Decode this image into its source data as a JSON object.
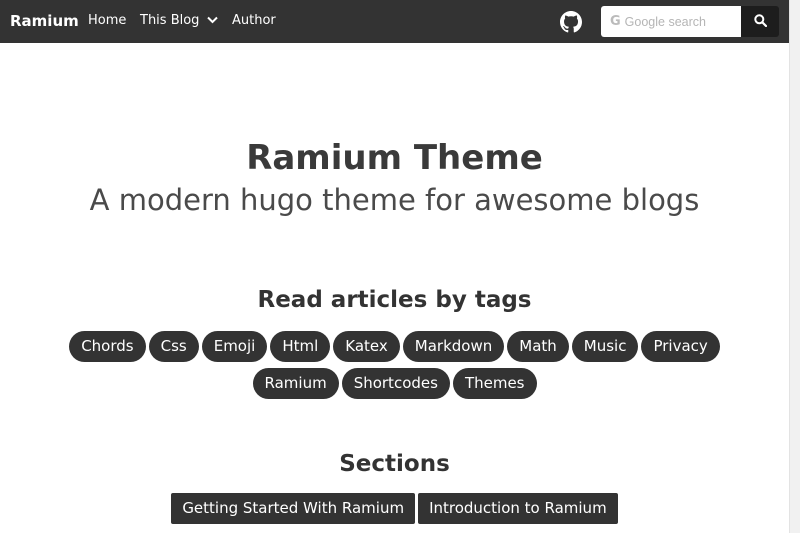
{
  "navbar": {
    "brand": "Ramium",
    "links": {
      "home": "Home",
      "blog": "This Blog",
      "author": "Author"
    },
    "search": {
      "placeholder": "Google search"
    },
    "colors": {
      "background": "#333333",
      "search_button": "#1d1d1d"
    }
  },
  "hero": {
    "title": "Ramium Theme",
    "subtitle": "A modern hugo theme for awesome blogs"
  },
  "tags": {
    "heading": "Read articles by tags",
    "row1": [
      "Chords",
      "Css",
      "Emoji",
      "Html",
      "Katex",
      "Markdown",
      "Math",
      "Music",
      "Privacy"
    ],
    "row2": [
      "Ramium",
      "Shortcodes",
      "Themes"
    ]
  },
  "sections": {
    "heading": "Sections",
    "items": [
      "Getting Started With Ramium",
      "Introduction to Ramium"
    ]
  },
  "icons": {
    "github": "github-icon",
    "dropdown": "chevron-down-icon",
    "search": "search-icon",
    "google": "google-g-icon"
  }
}
